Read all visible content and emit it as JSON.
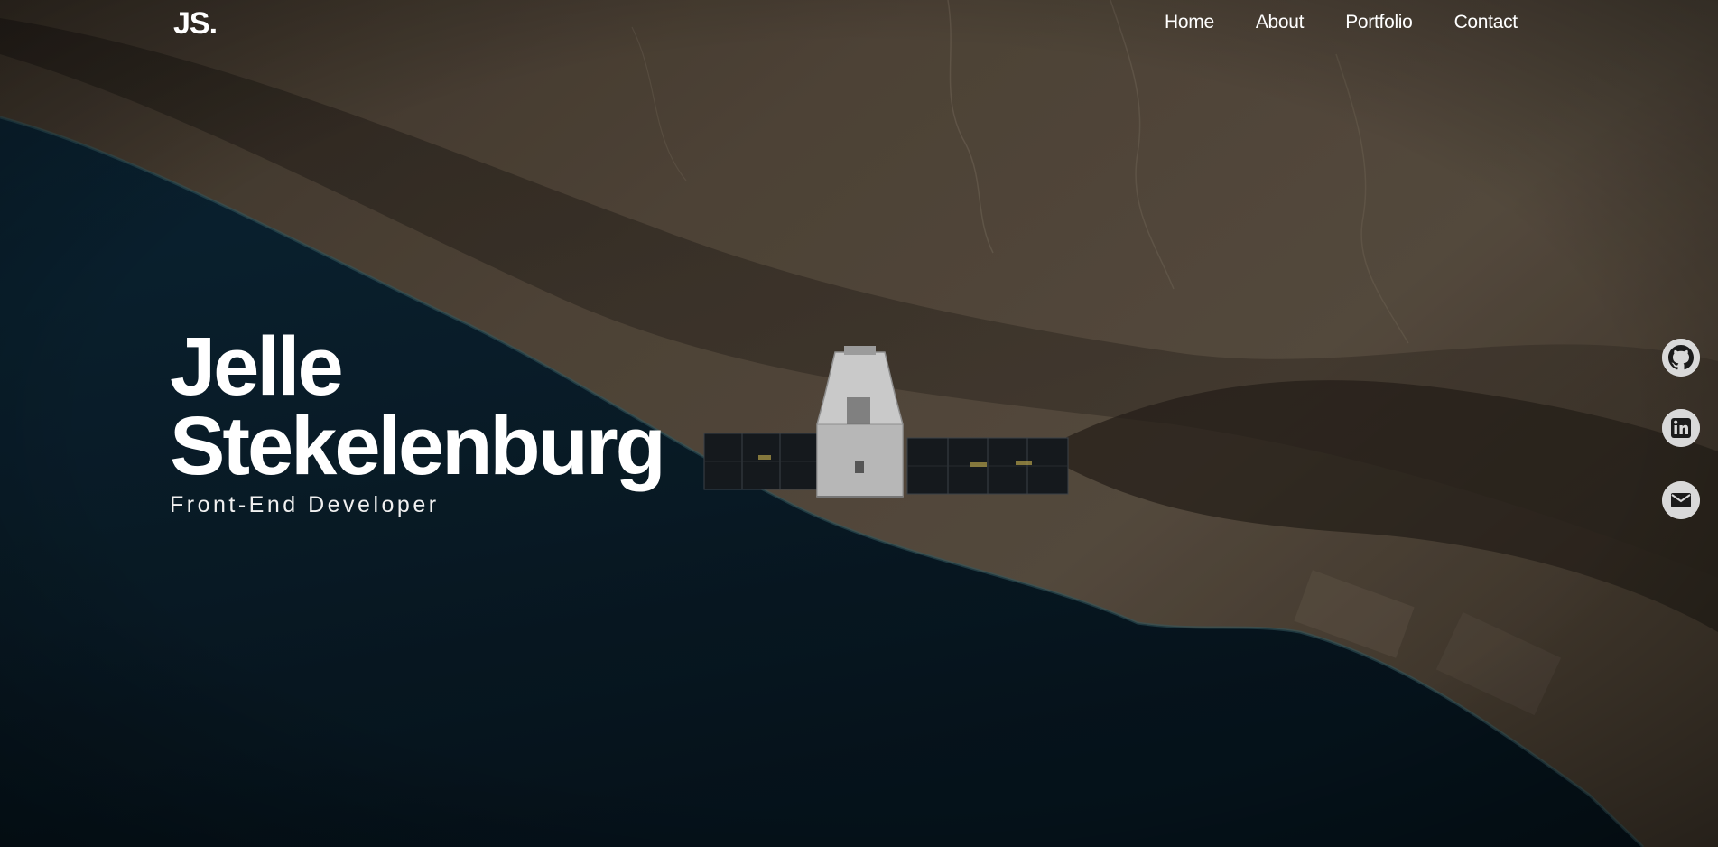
{
  "navbar": {
    "logo": "JS.",
    "links": [
      {
        "label": "Home"
      },
      {
        "label": "About"
      },
      {
        "label": "Portfolio"
      },
      {
        "label": "Contact"
      }
    ]
  },
  "hero": {
    "first_name": "Jelle",
    "last_name": "Stekelenburg",
    "role": "Front-End Developer",
    "background": "satellite-over-coastline-image"
  },
  "social": [
    {
      "icon": "github-icon"
    },
    {
      "icon": "linkedin-icon"
    },
    {
      "icon": "mail-icon"
    }
  ],
  "colors": {
    "text": "#ffffff",
    "ocean": "#0b2233",
    "land": "#5c4f40",
    "social_bg": "#d9d9d9"
  }
}
